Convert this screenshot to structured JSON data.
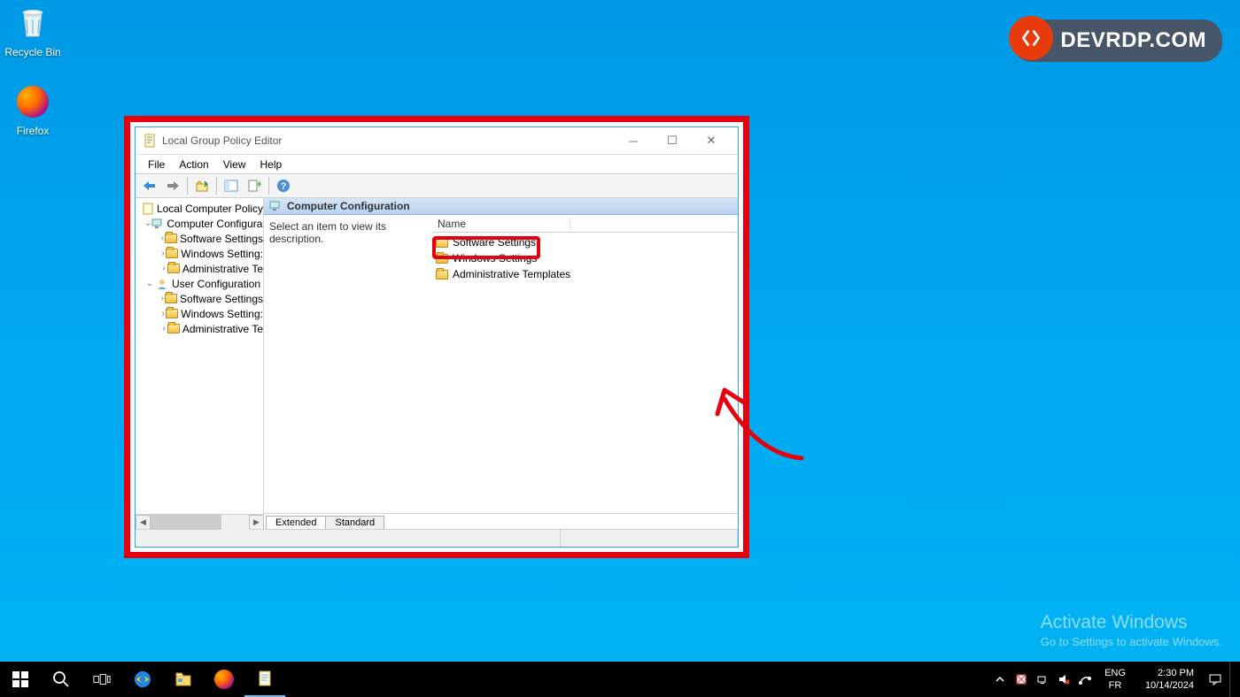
{
  "desktop": {
    "icons": [
      {
        "name": "recycle-bin",
        "label": "Recycle Bin"
      },
      {
        "name": "firefox",
        "label": "Firefox"
      }
    ]
  },
  "brand": "DEVRDP.COM",
  "activate": {
    "title": "Activate Windows",
    "subtitle": "Go to Settings to activate Windows."
  },
  "taskbar": {
    "lang1": "ENG",
    "lang2": "FR",
    "time": "2:30 PM",
    "date": "10/14/2024"
  },
  "window": {
    "title": "Local Group Policy Editor",
    "menus": [
      "File",
      "Action",
      "View",
      "Help"
    ],
    "tree": {
      "root": "Local Computer Policy",
      "n1": "Computer Configurat",
      "n1a": "Software Settings",
      "n1b": "Windows Setting:",
      "n1c": "Administrative Te",
      "n2": "User Configuration",
      "n2a": "Software Settings",
      "n2b": "Windows Setting:",
      "n2c": "Administrative Te"
    },
    "content": {
      "header": "Computer Configuration",
      "description": "Select an item to view its description.",
      "col_name": "Name",
      "items": [
        "Software Settings",
        "Windows Settings",
        "Administrative Templates"
      ]
    },
    "tabs": [
      "Extended",
      "Standard"
    ]
  }
}
